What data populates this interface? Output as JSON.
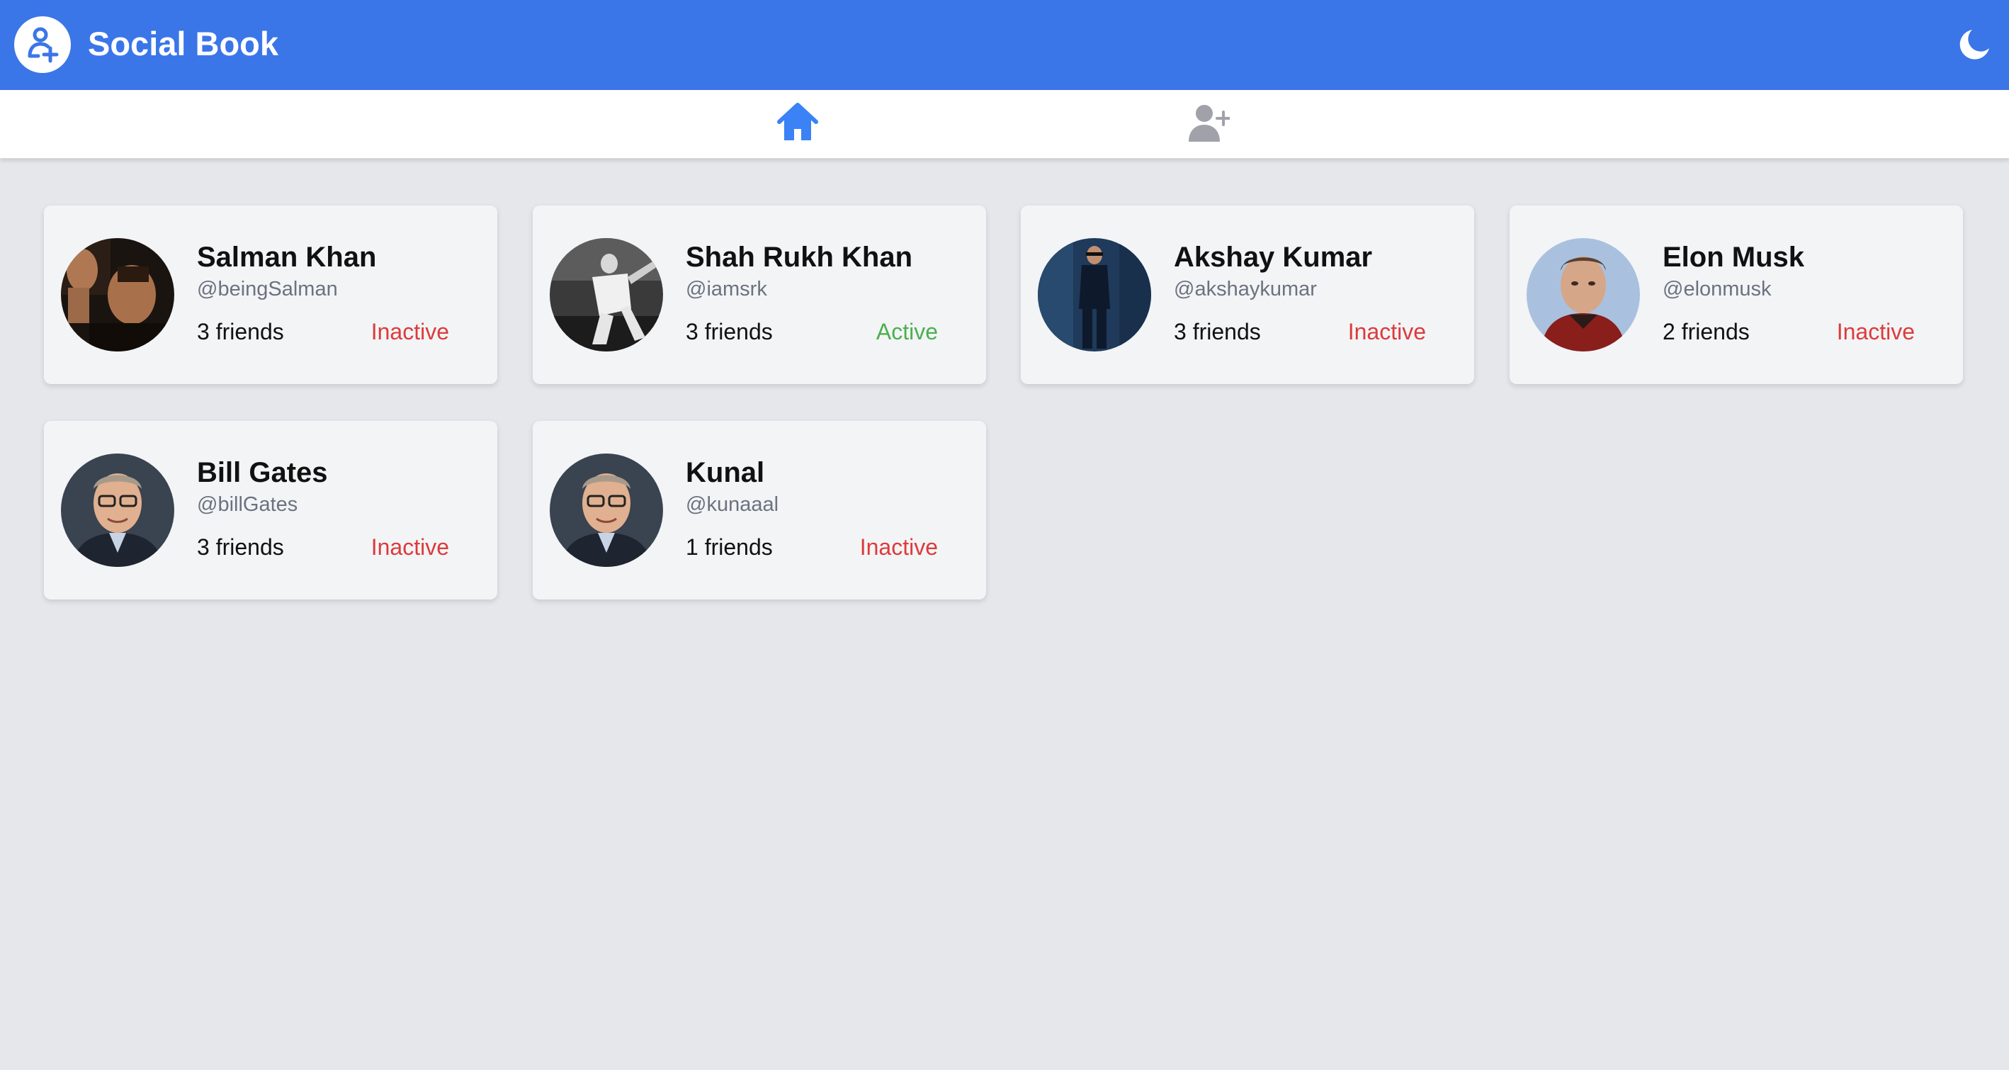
{
  "app": {
    "title": "Social Book",
    "accent_color": "#3b76e8",
    "icons": {
      "logo": "user-plus-icon",
      "theme_toggle": "moon-icon"
    }
  },
  "nav": {
    "tabs": [
      {
        "icon": "home-icon",
        "active": true,
        "color": "#3b82f6"
      },
      {
        "icon": "user-plus-icon",
        "active": false,
        "color": "#a1a1aa"
      }
    ]
  },
  "users": [
    {
      "name": "Salman Khan",
      "handle": "@beingSalman",
      "friends": "3 friends",
      "status": "Inactive"
    },
    {
      "name": "Shah Rukh Khan",
      "handle": "@iamsrk",
      "friends": "3 friends",
      "status": "Active"
    },
    {
      "name": "Akshay Kumar",
      "handle": "@akshaykumar",
      "friends": "3 friends",
      "status": "Inactive"
    },
    {
      "name": "Elon Musk",
      "handle": "@elonmusk",
      "friends": "2 friends",
      "status": "Inactive"
    },
    {
      "name": "Bill Gates",
      "handle": "@billGates",
      "friends": "3 friends",
      "status": "Inactive"
    },
    {
      "name": "Kunal",
      "handle": "@kunaaal",
      "friends": "1 friends",
      "status": "Inactive"
    }
  ],
  "status_colors": {
    "Active": "#4caf50",
    "Inactive": "#dc3b3b"
  }
}
